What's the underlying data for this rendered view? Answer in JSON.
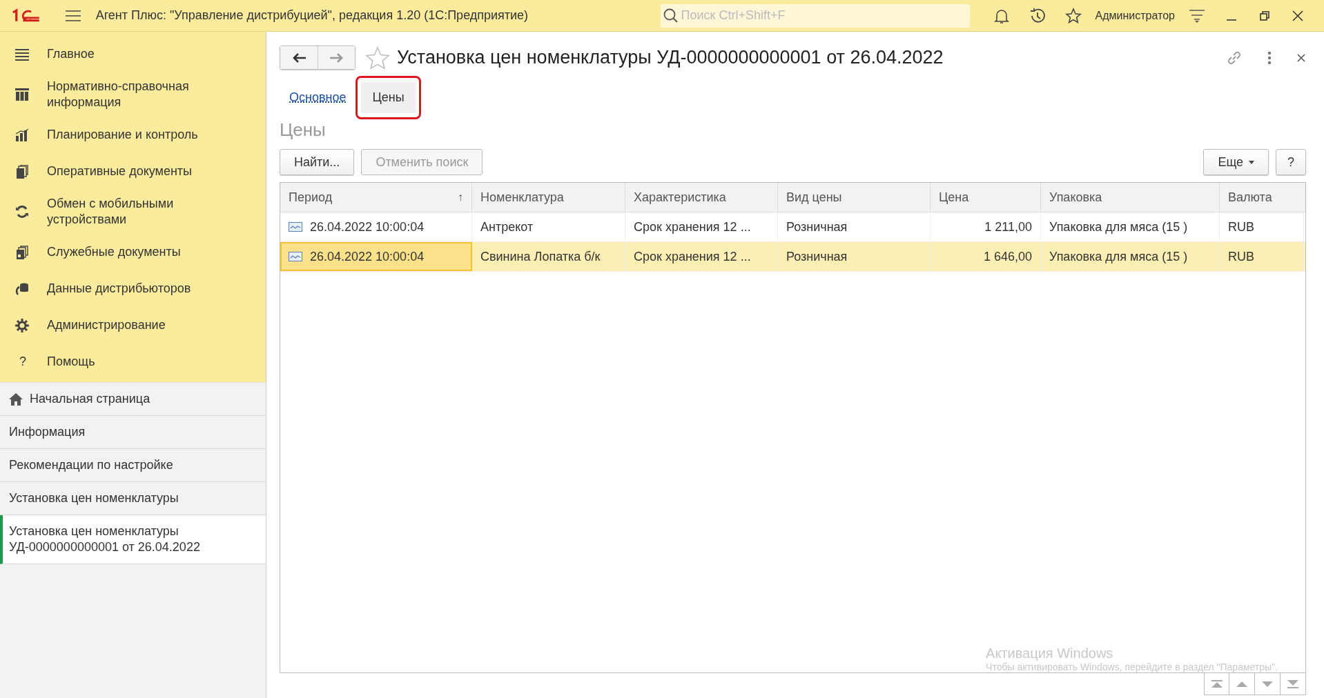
{
  "app_bar": {
    "title": "Агент Плюс: \"Управление дистрибуцией\", редакция 1.20  (1С:Предприятие)",
    "search": {
      "placeholder": "Поиск Ctrl+Shift+F"
    },
    "user": "Администратор"
  },
  "sidebar": {
    "sections": [
      {
        "label": "Главное",
        "kind": "menu"
      },
      {
        "label": "Нормативно-справочная информация",
        "kind": "grid"
      },
      {
        "label": "Планирование и контроль",
        "kind": "chart"
      },
      {
        "label": "Оперативные документы",
        "kind": "docs"
      },
      {
        "label": "Обмен с мобильными устройствами",
        "kind": "sync"
      },
      {
        "label": "Служебные документы",
        "kind": "docs2"
      },
      {
        "label": "Данные дистрибьюторов",
        "kind": "db"
      },
      {
        "label": "Администрирование",
        "kind": "gear"
      },
      {
        "label": "Помощь",
        "kind": "glyph",
        "glyph": "?"
      }
    ],
    "open_pages": [
      {
        "label": "Начальная страница",
        "home": true,
        "selected": false
      },
      {
        "label": "Информация",
        "home": false,
        "selected": false
      },
      {
        "label": "Рекомендации по настройке",
        "home": false,
        "selected": false
      },
      {
        "label": "Установка цен номенклатуры",
        "home": false,
        "selected": false
      },
      {
        "label": "Установка цен номенклатуры УД-0000000000001 от 26.04.2022",
        "home": false,
        "selected": true
      }
    ]
  },
  "form": {
    "title": "Установка цен номенклатуры УД-0000000000001 от 26.04.2022",
    "tabs": [
      {
        "label": "Основное",
        "selected": false
      },
      {
        "label": "Цены",
        "selected": true,
        "highlighted": true
      }
    ],
    "section_title": "Цены",
    "buttons": [
      {
        "label": "Найти...",
        "disabled": false
      },
      {
        "label": "Отменить поиск",
        "disabled": true
      }
    ],
    "more_button": "Еще",
    "help_button": "?",
    "table": {
      "columns": [
        {
          "label": "Период",
          "sort": "↑",
          "kind": "text"
        },
        {
          "label": "Номенклатура",
          "kind": "text"
        },
        {
          "label": "Характеристика",
          "kind": "text"
        },
        {
          "label": "Вид цены",
          "kind": "text"
        },
        {
          "label": "Цена",
          "kind": "number"
        },
        {
          "label": "Упаковка",
          "kind": "text"
        },
        {
          "label": "Валюта",
          "kind": "text"
        }
      ],
      "rows": [
        {
          "selected": false,
          "cells": [
            "26.04.2022 10:00:04",
            "Антрекот",
            "Срок хранения 12 ...",
            "Розничная",
            "1 211,00",
            "Упаковка для мяса (15 )",
            "RUB"
          ]
        },
        {
          "selected": true,
          "cells": [
            "26.04.2022 10:00:04",
            "Свинина Лопатка б/к",
            "Срок хранения 12 ...",
            "Розничная",
            "1 646,00",
            "Упаковка для мяса (15 )",
            "RUB"
          ]
        }
      ]
    }
  },
  "os_notice": {
    "title": "Активация Windows",
    "text": "Чтобы активировать Windows, перейдите в раздел \"Параметры\"."
  }
}
